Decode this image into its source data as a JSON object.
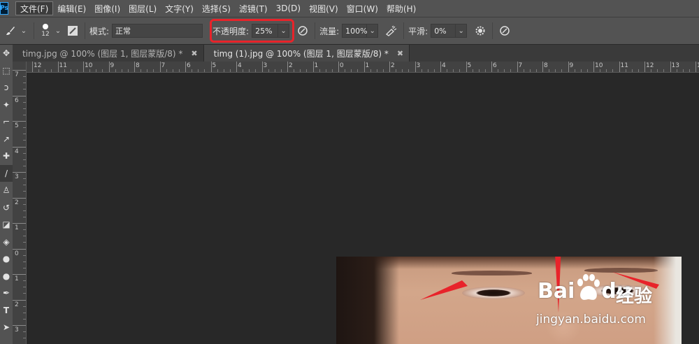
{
  "app": {
    "logo": "Ps"
  },
  "menu": [
    {
      "label": "文件(F)"
    },
    {
      "label": "编辑(E)"
    },
    {
      "label": "图像(I)"
    },
    {
      "label": "图层(L)"
    },
    {
      "label": "文字(Y)"
    },
    {
      "label": "选择(S)"
    },
    {
      "label": "滤镜(T)"
    },
    {
      "label": "3D(D)"
    },
    {
      "label": "视图(V)"
    },
    {
      "label": "窗口(W)"
    },
    {
      "label": "帮助(H)"
    }
  ],
  "options": {
    "brush_size": "12",
    "mode_label": "模式:",
    "mode_value": "正常",
    "opacity_label": "不透明度:",
    "opacity_value": "25%",
    "flow_label": "流量:",
    "flow_value": "100%",
    "smooth_label": "平滑:",
    "smooth_value": "0%"
  },
  "tabs": [
    {
      "label": "timg.jpg @ 100% (图层 1, 图层蒙版/8) *",
      "close": "✖",
      "active": false
    },
    {
      "label": "timg (1).jpg @ 100% (图层 1, 图层蒙版/8) *",
      "close": "✖",
      "active": true
    }
  ],
  "ruler_top": [
    "12",
    "11",
    "10",
    "9",
    "8",
    "7",
    "6",
    "5",
    "4",
    "3",
    "2",
    "1",
    "0",
    "1",
    "2",
    "3",
    "4",
    "5",
    "6",
    "7",
    "8",
    "9",
    "10",
    "11",
    "12",
    "13",
    "14"
  ],
  "ruler_left": [
    "7",
    "6",
    "5",
    "4",
    "3",
    "2",
    "1",
    "0",
    "1",
    "2",
    "3"
  ],
  "watermark": {
    "brand": "Bai",
    "brand2": "du",
    "cn": "经验",
    "url": "jingyan.baidu.com"
  },
  "colors": {
    "highlight": "#e8232a",
    "arrow": "#e8232a",
    "panel": "#535353",
    "canvas": "#282828"
  }
}
